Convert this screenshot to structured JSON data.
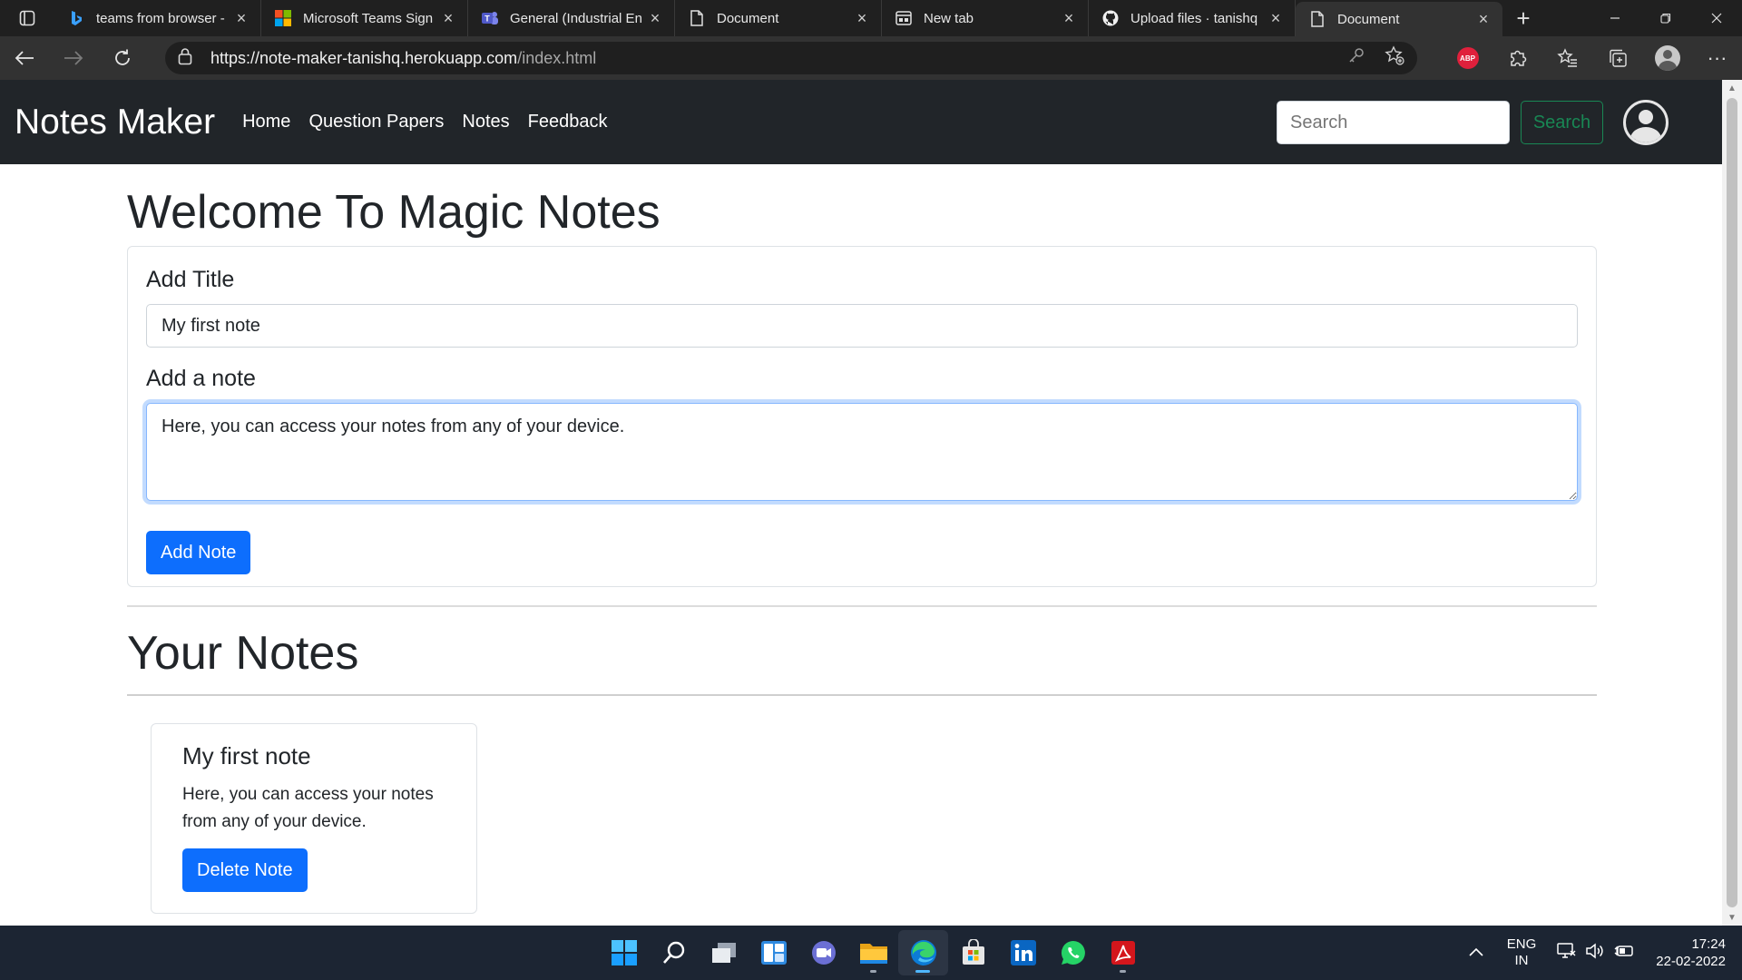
{
  "browser": {
    "tabs": [
      {
        "title": "teams from browser -",
        "icon": "bing-icon",
        "active": false
      },
      {
        "title": "Microsoft Teams Sign",
        "icon": "microsoft-logo-icon",
        "active": false
      },
      {
        "title": "General (Industrial En",
        "icon": "teams-icon",
        "active": false
      },
      {
        "title": "Document",
        "icon": "document-icon",
        "active": false
      },
      {
        "title": "New tab",
        "icon": "newtab-icon",
        "active": false
      },
      {
        "title": "Upload files · tanishq",
        "icon": "github-icon",
        "active": false
      },
      {
        "title": "Document",
        "icon": "document-icon",
        "active": true
      }
    ],
    "url_host": "https://note-maker-tanishq.herokuapp.com",
    "url_path": "/index.html"
  },
  "navbar": {
    "brand": "Notes Maker",
    "links": [
      "Home",
      "Question Papers",
      "Notes",
      "Feedback"
    ],
    "search_placeholder": "Search",
    "search_button": "Search"
  },
  "main": {
    "heading": "Welcome To Magic Notes",
    "title_label": "Add Title",
    "title_value": "My first note",
    "note_label": "Add a note",
    "note_value": "Here, you can access your notes from any of your device.",
    "add_button": "Add Note",
    "notes_heading": "Your Notes",
    "notes": [
      {
        "title": "My first note",
        "text": "Here, you can access your notes from any of your device.",
        "delete_label": "Delete Note"
      }
    ]
  },
  "taskbar": {
    "apps": [
      "windows-start-icon",
      "search-icon",
      "task-view-icon",
      "widgets-icon",
      "teams-chat-icon",
      "file-explorer-icon",
      "edge-icon",
      "store-icon",
      "linkedin-icon",
      "whatsapp-icon",
      "acrobat-icon"
    ],
    "lang_top": "ENG",
    "lang_bottom": "IN",
    "time": "17:24",
    "date": "22-02-2022"
  },
  "colors": {
    "navbar_bg": "#212529",
    "primary": "#0d6efd",
    "success": "#198754",
    "taskbar_bg": "#1c2533"
  }
}
